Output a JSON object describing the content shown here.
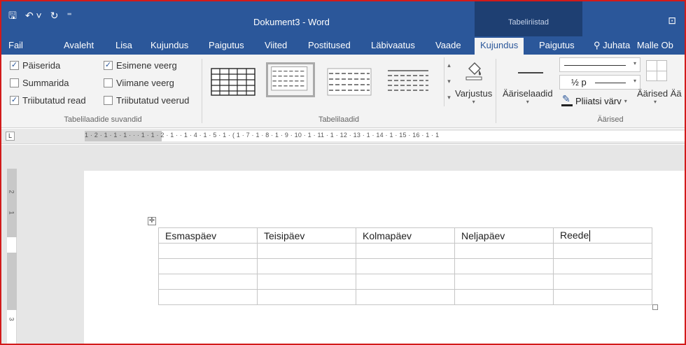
{
  "titlebar": {
    "doc_title": "Dokument3 - Word",
    "contextual_label": "Tabeliriistad",
    "qat": [
      "save-icon",
      "undo-icon",
      "redo-icon",
      "customize-icon"
    ]
  },
  "tabs": [
    {
      "label": "Fail"
    },
    {
      "label": "Avaleht"
    },
    {
      "label": "Lisa"
    },
    {
      "label": "Kujundus"
    },
    {
      "label": "Paigutus"
    },
    {
      "label": "Viited"
    },
    {
      "label": "Postitused"
    },
    {
      "label": "Läbivaatus"
    },
    {
      "label": "Vaade"
    },
    {
      "label": "Kujundus",
      "active": true
    },
    {
      "label": "Paigutus"
    }
  ],
  "tell_me": "Juhata",
  "user": "Malle Ob",
  "style_options": {
    "items": [
      {
        "label": "Päiserida",
        "checked": true
      },
      {
        "label": "Esimene veerg",
        "checked": true
      },
      {
        "label": "Summarida",
        "checked": false
      },
      {
        "label": "Viimane veerg",
        "checked": false
      },
      {
        "label": "Triibutatud read",
        "checked": true
      },
      {
        "label": "Triibutatud veerud",
        "checked": false
      }
    ],
    "group_label": "Tabelilaadide suvandid"
  },
  "table_styles": {
    "group_label": "Tabelilaadid",
    "shading_label": "Varjustus"
  },
  "borders": {
    "group_label": "Äärised",
    "border_styles_label": "Äärisel aadid",
    "border_styles_label_full": "Äärisel­aadid",
    "line_weight": "½ p",
    "pen_color": "Pliiatsi värv",
    "borders_label": "Äärised Ää"
  },
  "ruler": {
    "ticks": "1 · 2 · 1 · 1 · 1 ·   ·   · 1 · 1 · 2 · 1 ·   · 1 · 4 · 1 · 5 · 1 · (  1 · 7 · 1 · 8 · 1 · 9   · 10 · 1 · 11 · 1 · 12 ·   13 · 1 · 14 · 1 · 15 ·   16 · 1 · 1",
    "vticks": [
      "2",
      "1",
      "3"
    ]
  },
  "document_table": {
    "rows": [
      [
        "Esmaspäev",
        "Teisipäev",
        "Kolmapäev",
        "Neljapäev",
        "Reede"
      ],
      [
        "",
        "",
        "",
        "",
        ""
      ],
      [
        "",
        "",
        "",
        "",
        ""
      ],
      [
        "",
        "",
        "",
        "",
        ""
      ],
      [
        "",
        "",
        "",
        "",
        ""
      ]
    ]
  }
}
